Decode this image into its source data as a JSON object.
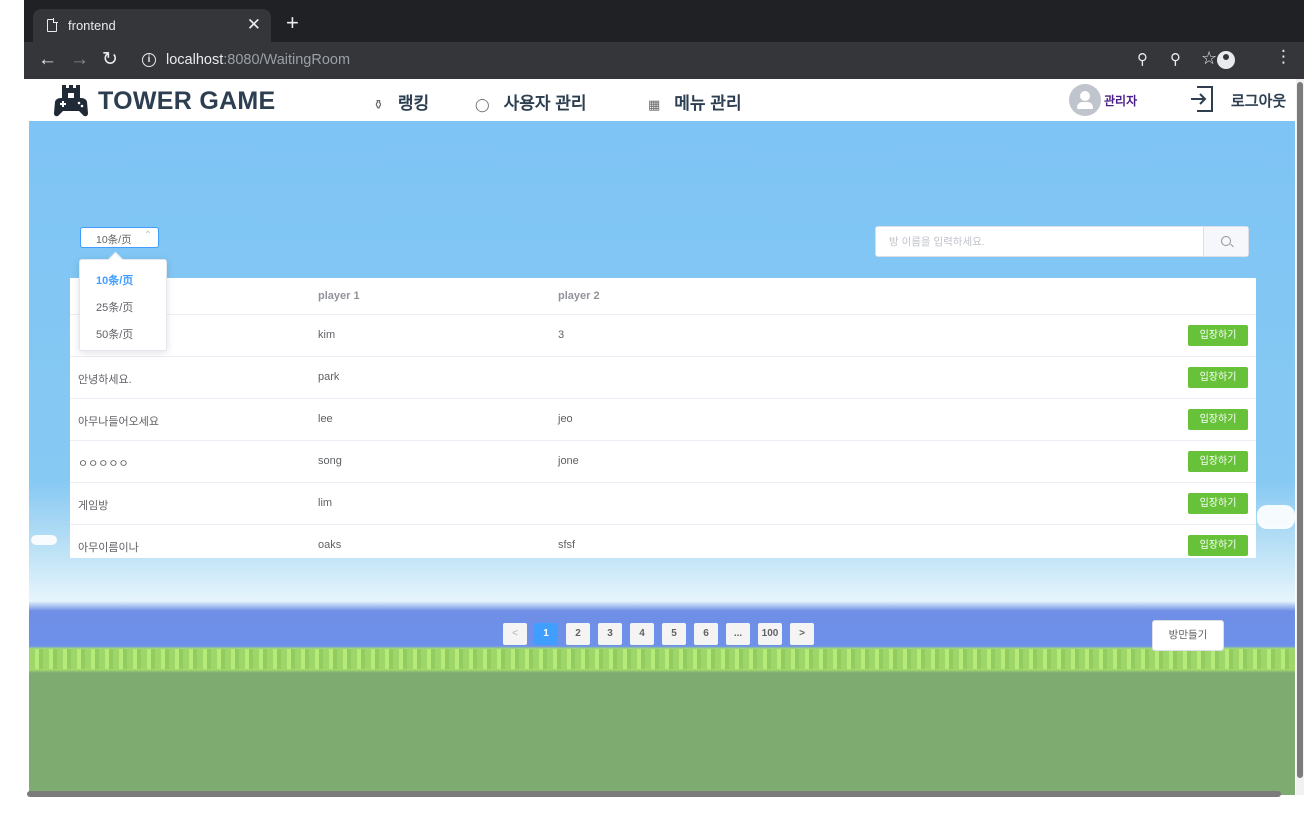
{
  "browser": {
    "tab_title": "frontend",
    "new_tab": "+",
    "close_tab": "✕",
    "url_host": "localhost",
    "url_rest": ":8080/WaitingRoom"
  },
  "header": {
    "logo_text": "TOWER GAME",
    "menu": [
      {
        "label": "랭킹",
        "icon": "trophy-icon"
      },
      {
        "label": "사용자 관리",
        "icon": "user-icon"
      },
      {
        "label": "메뉴 관리",
        "icon": "grid-icon"
      }
    ],
    "user_name": "관리자",
    "logout_label": "로그아웃"
  },
  "page_size": {
    "selected": "10条/页",
    "options": [
      "10条/页",
      "25条/页",
      "50条/页"
    ]
  },
  "search": {
    "placeholder": "방 이름을 입력하세요."
  },
  "table": {
    "columns": [
      "",
      "player 1",
      "player 2"
    ],
    "rows": [
      {
        "room": "",
        "player1": "kim",
        "player2": "3"
      },
      {
        "room": "안녕하세요.",
        "player1": "park",
        "player2": ""
      },
      {
        "room": "아무나들어오세요",
        "player1": "lee",
        "player2": "jeo"
      },
      {
        "room": "ㅇㅇㅇㅇㅇ",
        "player1": "song",
        "player2": "jone"
      },
      {
        "room": "게임방",
        "player1": "lim",
        "player2": ""
      },
      {
        "room": "아무이름이나",
        "player1": "oaks",
        "player2": "sfsf"
      }
    ],
    "enter_label": "입장하기"
  },
  "pagination": {
    "prev": "<",
    "pages": [
      "1",
      "2",
      "3",
      "4",
      "5",
      "6",
      "...",
      "100"
    ],
    "current": "1",
    "next": ">"
  },
  "make_room_label": "방만들기",
  "colors": {
    "primary": "#409eff",
    "success": "#67c23a",
    "sky": "#7ec4f4",
    "grass": "#7eac70"
  }
}
